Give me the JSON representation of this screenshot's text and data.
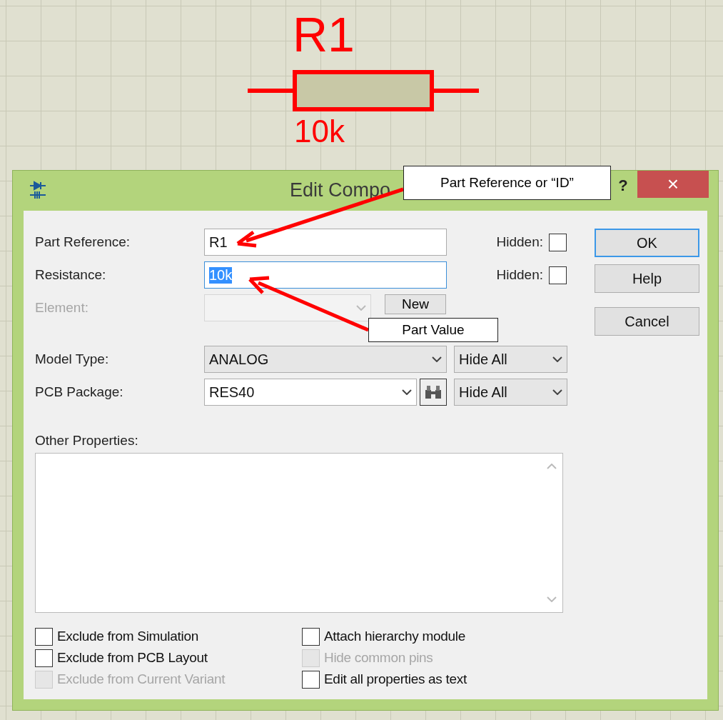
{
  "schematic": {
    "reference": "R1",
    "value": "10k"
  },
  "dialog": {
    "title": "Edit Compo",
    "help": "?",
    "close": "×"
  },
  "fields": [
    {
      "kind": "text",
      "label": "Part Reference:",
      "value": "R1",
      "focused": false,
      "hidden_label": "Hidden:",
      "hidden": false
    },
    {
      "kind": "text",
      "label": "Resistance:",
      "value": "10k",
      "focused": true,
      "hidden_label": "Hidden:",
      "hidden": false
    },
    {
      "kind": "combo",
      "label": "Element:",
      "disabled": true,
      "button": "New"
    },
    {
      "kind": "select",
      "label": "Model Type:",
      "value": "ANALOG",
      "visibility": "Hide All"
    },
    {
      "kind": "search",
      "label": "PCB Package:",
      "value": "RES40",
      "visibility": "Hide All"
    }
  ],
  "other_properties": {
    "label": "Other Properties:"
  },
  "checkbox_columns": [
    [
      {
        "label": "Exclude from Simulation",
        "checked": false,
        "disabled": false
      },
      {
        "label": "Exclude from PCB Layout",
        "checked": false,
        "disabled": false
      },
      {
        "label": "Exclude from Current Variant",
        "checked": false,
        "disabled": true
      }
    ],
    [
      {
        "label": "Attach hierarchy module",
        "checked": false,
        "disabled": false
      },
      {
        "label": "Hide common pins",
        "checked": false,
        "disabled": true
      },
      {
        "label": "Edit all properties as text",
        "checked": false,
        "disabled": false
      }
    ]
  ],
  "buttons": [
    {
      "label": "OK",
      "default": true
    },
    {
      "label": "Help",
      "default": false
    },
    {
      "label": "Cancel",
      "default": false
    }
  ],
  "callouts": [
    {
      "text": "Part Reference or “ID”"
    },
    {
      "text": "Part Value"
    }
  ]
}
